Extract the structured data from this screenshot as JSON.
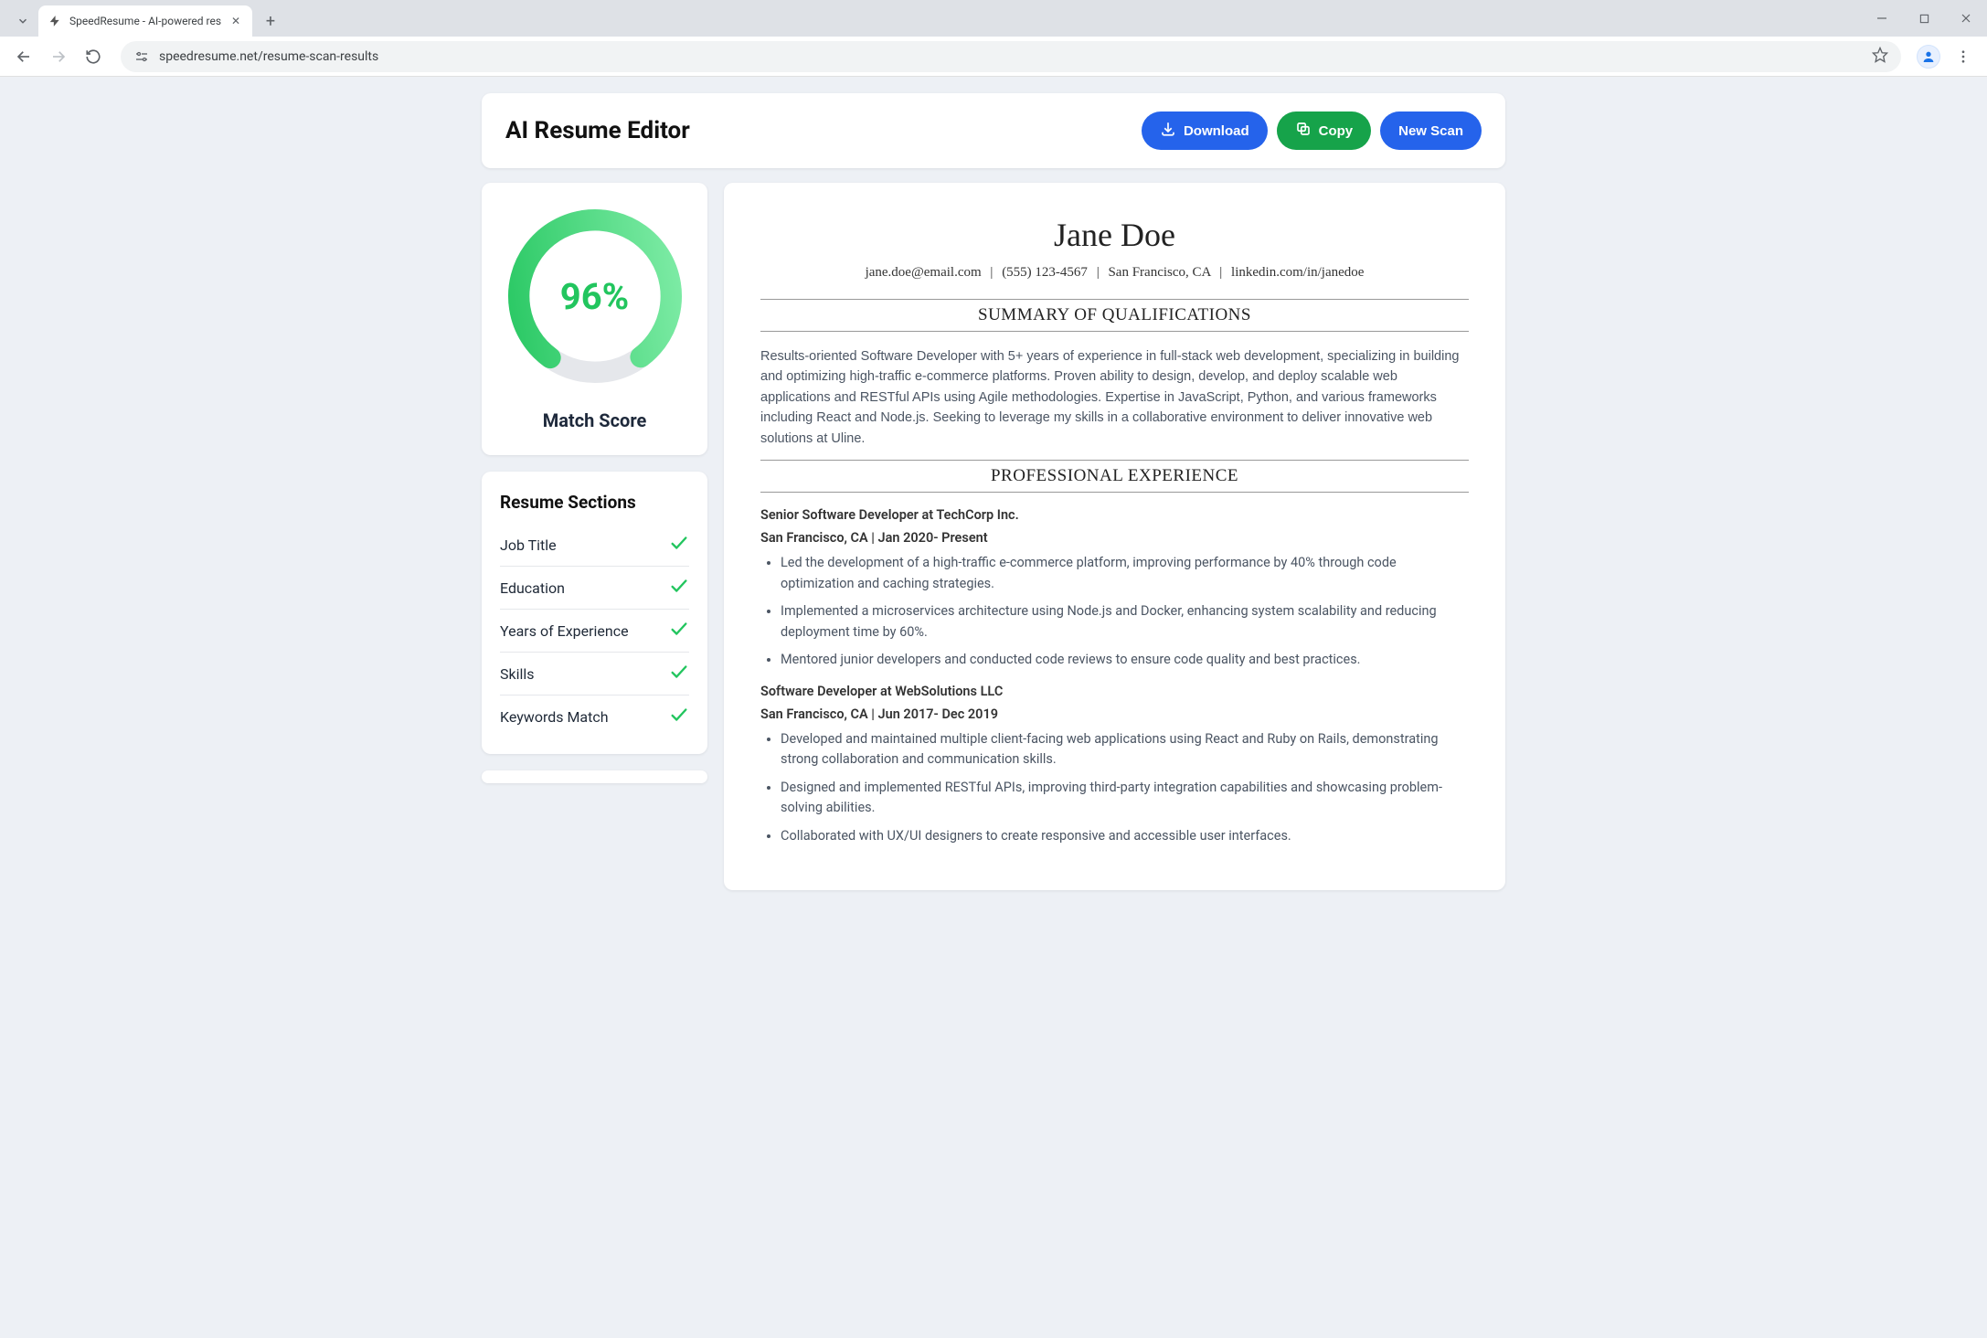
{
  "browser": {
    "tab_title": "SpeedResume - AI-powered res",
    "url_display": "speedresume.net/resume-scan-results"
  },
  "header": {
    "title": "AI Resume Editor",
    "download_label": "Download",
    "copy_label": "Copy",
    "new_scan_label": "New Scan"
  },
  "gauge": {
    "value_display": "96%",
    "percent": 96,
    "label": "Match Score"
  },
  "sections": {
    "title": "Resume Sections",
    "items": [
      {
        "label": "Job Title",
        "status": "check"
      },
      {
        "label": "Education",
        "status": "check"
      },
      {
        "label": "Years of Experience",
        "status": "check"
      },
      {
        "label": "Skills",
        "status": "check"
      },
      {
        "label": "Keywords Match",
        "status": "check"
      }
    ]
  },
  "resume": {
    "name": "Jane Doe",
    "contact": {
      "email": "jane.doe@email.com",
      "phone": "(555) 123-4567",
      "location": "San Francisco, CA",
      "linkedin": "linkedin.com/in/janedoe"
    },
    "summary_heading": "SUMMARY OF QUALIFICATIONS",
    "summary": "Results-oriented Software Developer with 5+ years of experience in full-stack web development, specializing in building and optimizing high-traffic e-commerce platforms. Proven ability to design, develop, and deploy scalable web applications and RESTful APIs using Agile methodologies. Expertise in JavaScript, Python, and various frameworks including React and Node.js. Seeking to leverage my skills in a collaborative environment to deliver innovative web solutions at Uline.",
    "experience_heading": "PROFESSIONAL EXPERIENCE",
    "jobs": [
      {
        "title_line": "Senior Software Developer at TechCorp Inc.",
        "meta": "San Francisco, CA | Jan 2020- Present",
        "bullets": [
          "Led the development of a high-traffic e-commerce platform, improving performance by 40% through code optimization and caching strategies.",
          "Implemented a microservices architecture using Node.js and Docker, enhancing system scalability and reducing deployment time by 60%.",
          "Mentored junior developers and conducted code reviews to ensure code quality and best practices."
        ]
      },
      {
        "title_line": "Software Developer at WebSolutions LLC",
        "meta": "San Francisco, CA | Jun 2017- Dec 2019",
        "bullets": [
          "Developed and maintained multiple client-facing web applications using React and Ruby on Rails, demonstrating strong collaboration and communication skills.",
          "Designed and implemented RESTful APIs, improving third-party integration capabilities and showcasing problem-solving abilities.",
          "Collaborated with UX/UI designers to create responsive and accessible user interfaces."
        ]
      }
    ]
  }
}
